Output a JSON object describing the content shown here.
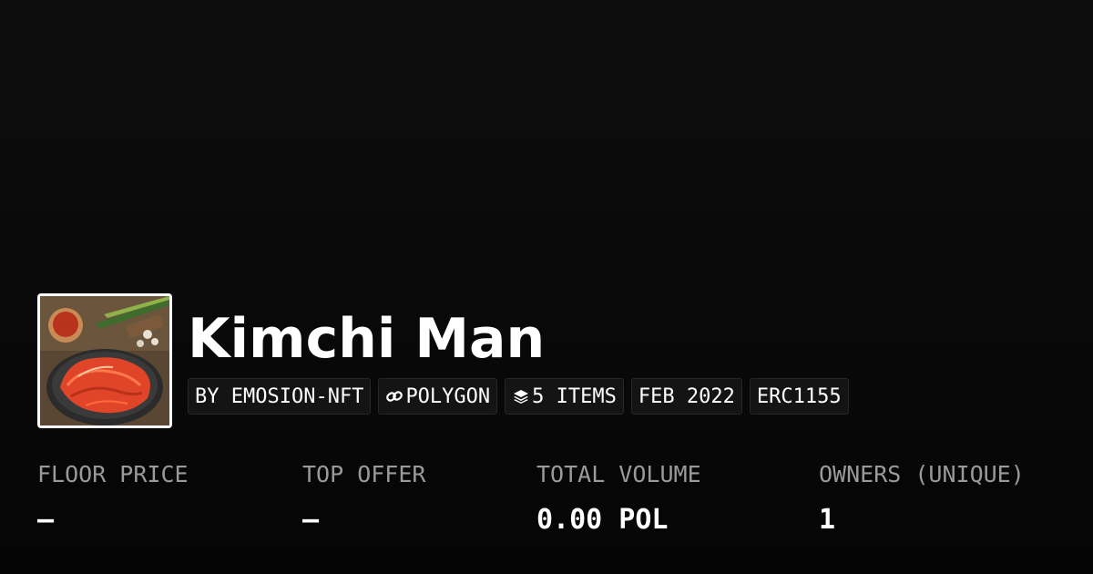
{
  "collection": {
    "name": "Kimchi Man",
    "thumbnail_alt": "kimchi-dish-image"
  },
  "tags": [
    {
      "label": "BY EMOSION-NFT",
      "icon": ""
    },
    {
      "label": "POLYGON",
      "icon": "chain-link-icon"
    },
    {
      "label": "5 ITEMS",
      "icon": "layers-icon"
    },
    {
      "label": "FEB 2022",
      "icon": ""
    },
    {
      "label": "ERC1155",
      "icon": ""
    }
  ],
  "stats": [
    {
      "label": "FLOOR PRICE",
      "value": "–"
    },
    {
      "label": "TOP OFFER",
      "value": "–"
    },
    {
      "label": "TOTAL VOLUME",
      "value": "0.00 POL"
    },
    {
      "label": "OWNERS (UNIQUE)",
      "value": "1"
    }
  ],
  "colors": {
    "background": "#0a0a0a",
    "text": "#ffffff",
    "muted": "#9a9a9a",
    "tag_bg": "#141414",
    "kimchi": "#e0452a"
  }
}
